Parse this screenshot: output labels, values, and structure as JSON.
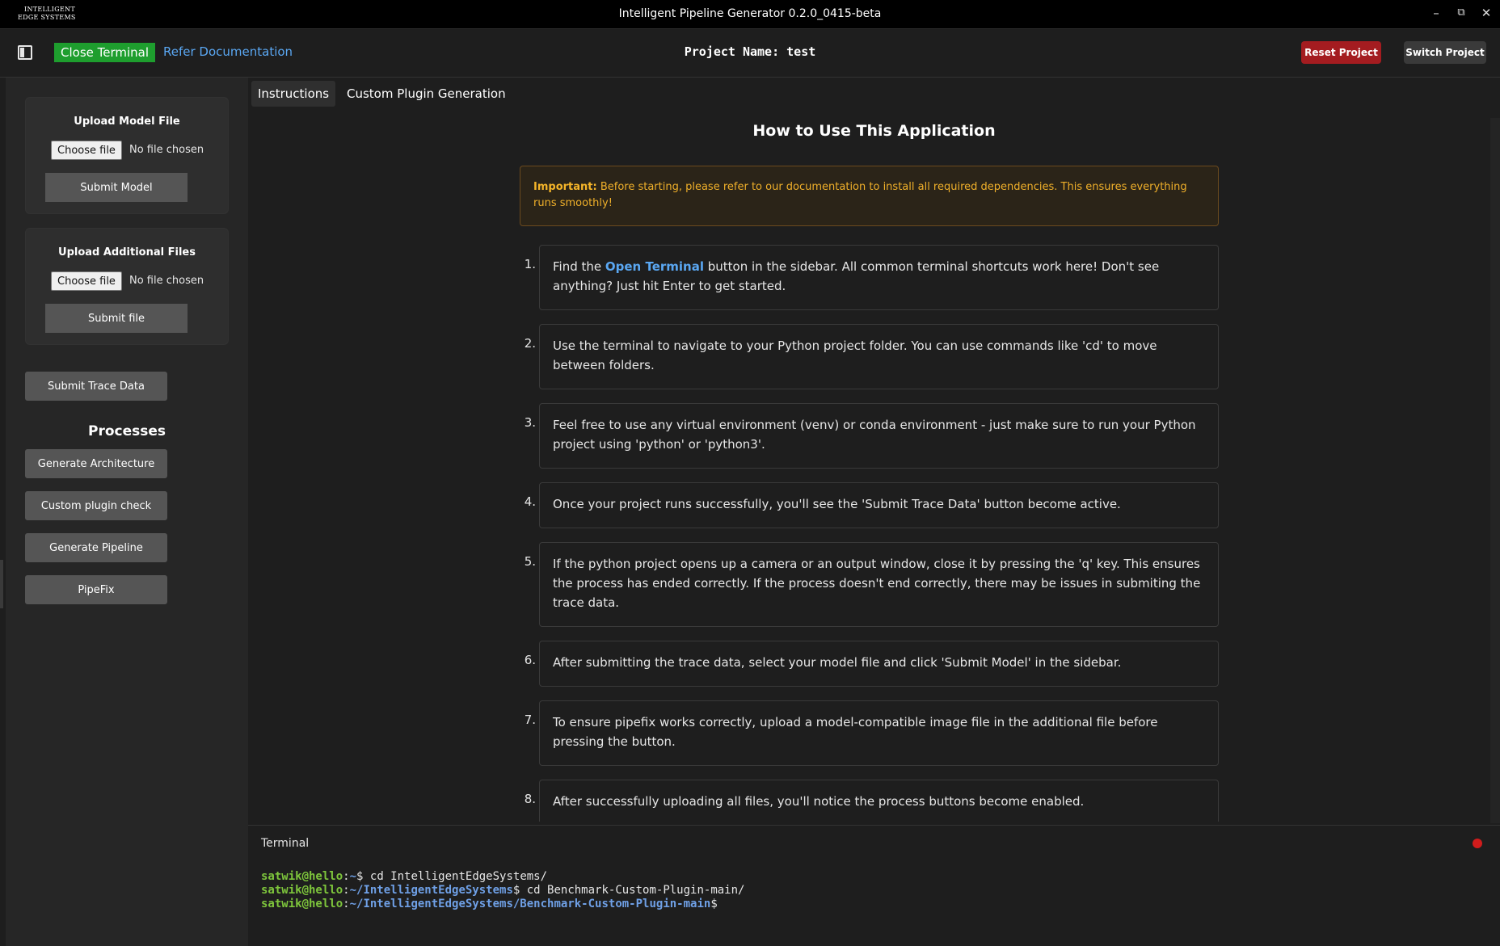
{
  "window": {
    "logo_line1": "INTELLIGENT",
    "logo_line2": "EDGE SYSTEMS",
    "title": "Intelligent Pipeline Generator 0.2.0_0415-beta",
    "minimize": "–",
    "maximize": "⧉",
    "close": "✕"
  },
  "toolbar": {
    "close_terminal": "Close Terminal",
    "refer_docs": "Refer Documentation",
    "project_name": "Project Name: test",
    "reset_project": "Reset Project",
    "switch_project": "Switch Project"
  },
  "sidebar": {
    "upload_model": {
      "title": "Upload Model File",
      "choose": "Choose file",
      "status": "No file chosen",
      "submit": "Submit Model"
    },
    "upload_additional": {
      "title": "Upload Additional Files",
      "choose": "Choose file",
      "status": "No file chosen",
      "submit": "Submit file"
    },
    "submit_trace": "Submit Trace Data",
    "processes_title": "Processes",
    "processes": [
      "Generate Architecture",
      "Custom plugin check",
      "Generate Pipeline",
      "PipeFix"
    ]
  },
  "main": {
    "tabs": [
      "Instructions",
      "Custom Plugin Generation"
    ],
    "heading": "How to Use This Application",
    "alert_strong": "Important:",
    "alert_text": " Before starting, please refer to our documentation to install all required dependencies. This ensures everything runs smoothly!",
    "steps": [
      {
        "num": "1.",
        "pre": "Find the ",
        "highlight": "Open Terminal",
        "post": " button in the sidebar. All common terminal shortcuts work here! Don't see anything? Just hit Enter to get started."
      },
      {
        "num": "2.",
        "text": "Use the terminal to navigate to your Python project folder. You can use commands like 'cd' to move between folders."
      },
      {
        "num": "3.",
        "text": "Feel free to use any virtual environment (venv) or conda environment - just make sure to run your Python project using 'python' or 'python3'."
      },
      {
        "num": "4.",
        "text": "Once your project runs successfully, you'll see the 'Submit Trace Data' button become active."
      },
      {
        "num": "5.",
        "text": "If the python project opens up a camera or an output window, close it by pressing the 'q' key. This ensures the process has ended correctly. If the process doesn't end correctly, there may be issues in submiting the trace data."
      },
      {
        "num": "6.",
        "text": "After submitting the trace data, select your model file and click 'Submit Model' in the sidebar."
      },
      {
        "num": "7.",
        "text": "To ensure pipefix works correctly, upload a model-compatible image file in the additional file before pressing the button."
      },
      {
        "num": "8.",
        "text": "After successfully uploading all files, you'll notice the process buttons become enabled."
      }
    ]
  },
  "terminal": {
    "label": "Terminal",
    "lines": [
      {
        "user": "satwik@hello",
        "sep": ":",
        "path": "~",
        "cmd": "$ cd IntelligentEdgeSystems/"
      },
      {
        "user": "satwik@hello",
        "sep": ":",
        "path": "~/IntelligentEdgeSystems",
        "cmd": "$ cd Benchmark-Custom-Plugin-main/"
      },
      {
        "user": "satwik@hello",
        "sep": ":",
        "path": "~/IntelligentEdgeSystems/Benchmark-Custom-Plugin-main",
        "cmd": "$"
      }
    ]
  }
}
